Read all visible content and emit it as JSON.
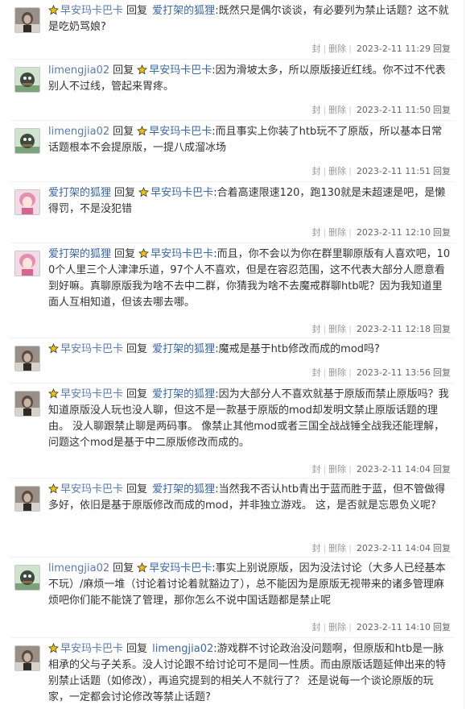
{
  "labels": {
    "reply_word": "回复",
    "seal": "封",
    "delete": "删除",
    "reply_link": "回复"
  },
  "comments": [
    {
      "author": "早安玛卡巴卡",
      "author_badge": true,
      "target": "爱打架的狐狸",
      "target_badge": false,
      "text": ":既然只是偶尔谈谈，有必要列为禁止话题？这不就是吃奶骂娘?",
      "time": "2023-2-11 11:29"
    },
    {
      "author": "limengjia02",
      "author_badge": false,
      "target": "早安玛卡巴卡",
      "target_badge": true,
      "text": ":因为滑坡太多，所以原版接近红线。你不过不代表别人不过线，管起来胃疼。",
      "time": "2023-2-11 11:50"
    },
    {
      "author": "limengjia02",
      "author_badge": false,
      "target": "早安玛卡巴卡",
      "target_badge": true,
      "text": ":而且事实上你装了htb玩不了原版，所以基本日常话题根本不会提原版，一提八成溜冰场",
      "time": "2023-2-11 11:51"
    },
    {
      "author": "爱打架的狐狸",
      "author_badge": false,
      "target": "早安玛卡巴卡",
      "target_badge": true,
      "text": ":合着高速限速120，跑130就是未超速是吧，是懒得罚，不是没犯错",
      "time": "2023-2-11 12:10"
    },
    {
      "author": "爱打架的狐狸",
      "author_badge": false,
      "target": "早安玛卡巴卡",
      "target_badge": true,
      "text": ":而且，你不会以为你在群里聊原版有人喜欢吧，100个人里三个人津津乐道，97个人不喜欢，但是在容忍范围，这不代表大部分人愿意看到好嘛。真聊原版我为啥不去中二群，你猜我为啥不去魔戒群聊htb呢？因为我知道里面人互相知道，但该去哪去哪。",
      "time": "2023-2-11 12:18"
    },
    {
      "author": "早安玛卡巴卡",
      "author_badge": true,
      "target": "爱打架的狐狸",
      "target_badge": false,
      "text": ":魔戒是基于htb修改而成的mod吗?",
      "time": "2023-2-11 13:56"
    },
    {
      "author": "早安玛卡巴卡",
      "author_badge": true,
      "target": "爱打架的狐狸",
      "target_badge": false,
      "text": ":因为大部分人不喜欢就基于原版而禁止原版吗？我知道原版没人玩也没人聊，但这不是一款基于原版的mod却发明文禁止原版话题的理由。 没人聊跟禁止聊是两码事。 像禁止其他mod或者三国全战战锤全战我还能理解，问题这个mod是基于中二原版修改而成的。",
      "time": "2023-2-11 14:04"
    },
    {
      "author": "早安玛卡巴卡",
      "author_badge": true,
      "target": "爱打架的狐狸",
      "target_badge": false,
      "text": ":当然我不否认htb青出于蓝而胜于蓝，但不管做得多好，依旧是基于原版修改而成的mod，并非独立游戏。 这，是否就是忘恩负义呢?",
      "time": "2023-2-11 14:04"
    },
    {
      "author": "limengjia02",
      "author_badge": false,
      "target": "早安玛卡巴卡",
      "target_badge": true,
      "text": ":事实上别说原版，因为没法讨论（大多人已经基本不玩）/麻烦一堆（讨论着讨论着就豁边了），总不能因为是原版无视带来的诸多管理麻烦吧你们能不能饶了管理，那你怎么不说中国话题都是禁止呢",
      "time": "2023-2-11 14:10"
    },
    {
      "author": "早安玛卡巴卡",
      "author_badge": true,
      "target": "limengjia02",
      "target_badge": false,
      "text": ":游戏群不讨论政治没问题啊，但原版和htb是一脉相承的父与子关系。没人讨论跟不给讨论可不是同一性质。而由原版话题延伸出来的特别禁止话题（如修改），再追究提到的相关人不就行了？ 还是说每一个谈论原版的玩家，一定都会讨论修改等禁止话题?",
      "time": ""
    }
  ]
}
